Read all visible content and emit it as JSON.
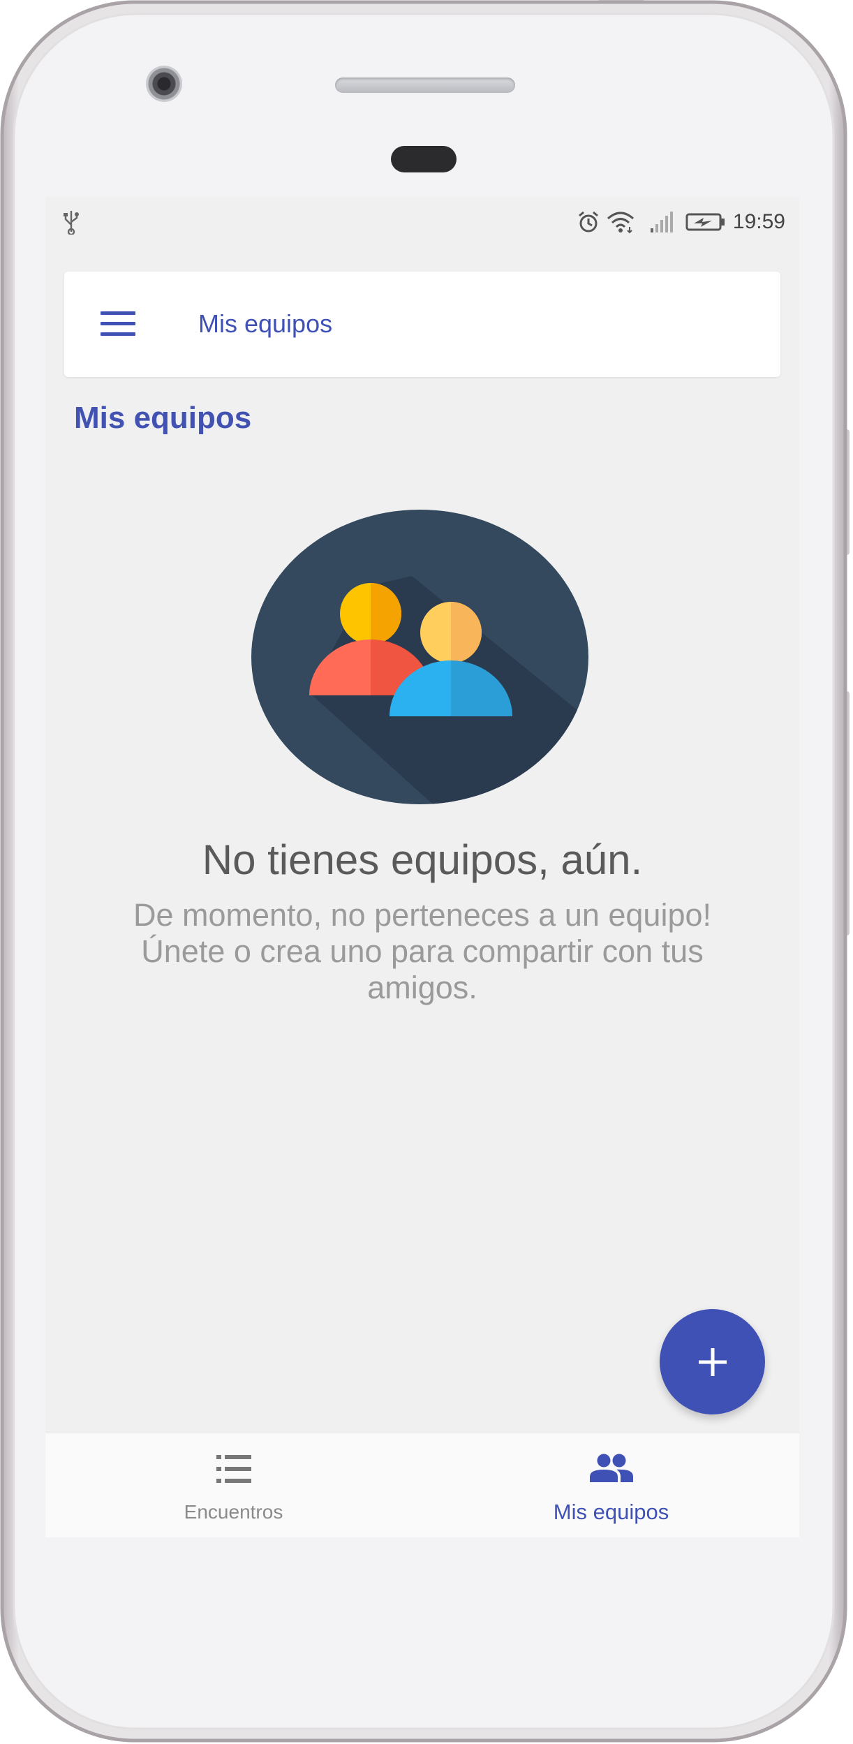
{
  "status_bar": {
    "time": "19:59",
    "icons": [
      "usb-icon",
      "alarm-icon",
      "wifi-icon",
      "signal-icon",
      "battery-charging-icon"
    ]
  },
  "toolbar": {
    "title": "Mis equipos",
    "menu_icon": "menu-icon"
  },
  "section": {
    "title": "Mis equipos"
  },
  "empty_state": {
    "illustration": "teams-people-icon",
    "title": "No tienes equipos, aún.",
    "body_line1": "De momento, no perteneces a un equipo!",
    "body_line2": "Únete o crea uno para compartir con tus amigos."
  },
  "fab": {
    "icon": "add-icon"
  },
  "bottom_nav": {
    "items": [
      {
        "label": "Encuentros",
        "icon": "list-icon",
        "active": false
      },
      {
        "label": "Mis equipos",
        "icon": "group-icon",
        "active": true
      }
    ]
  },
  "colors": {
    "primary": "#3f51b5",
    "screen_background": "#f0f0f1",
    "illustration_circle": "#34495e"
  }
}
